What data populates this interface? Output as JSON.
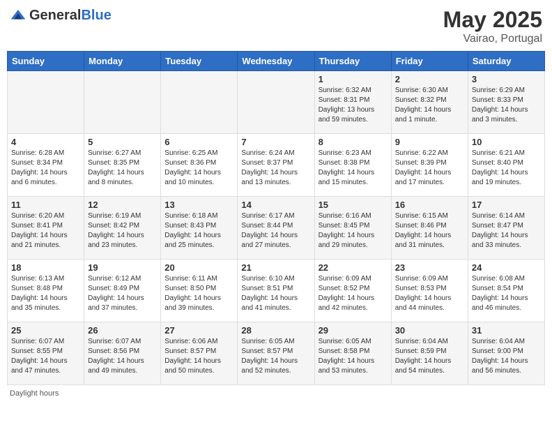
{
  "logo": {
    "general": "General",
    "blue": "Blue"
  },
  "title": "May 2025",
  "location": "Vairao, Portugal",
  "days_of_week": [
    "Sunday",
    "Monday",
    "Tuesday",
    "Wednesday",
    "Thursday",
    "Friday",
    "Saturday"
  ],
  "footer": "Daylight hours",
  "weeks": [
    [
      {
        "day": "",
        "sunrise": "",
        "sunset": "",
        "daylight": ""
      },
      {
        "day": "",
        "sunrise": "",
        "sunset": "",
        "daylight": ""
      },
      {
        "day": "",
        "sunrise": "",
        "sunset": "",
        "daylight": ""
      },
      {
        "day": "",
        "sunrise": "",
        "sunset": "",
        "daylight": ""
      },
      {
        "day": "1",
        "sunrise": "Sunrise: 6:32 AM",
        "sunset": "Sunset: 8:31 PM",
        "daylight": "Daylight: 13 hours and 59 minutes."
      },
      {
        "day": "2",
        "sunrise": "Sunrise: 6:30 AM",
        "sunset": "Sunset: 8:32 PM",
        "daylight": "Daylight: 14 hours and 1 minute."
      },
      {
        "day": "3",
        "sunrise": "Sunrise: 6:29 AM",
        "sunset": "Sunset: 8:33 PM",
        "daylight": "Daylight: 14 hours and 3 minutes."
      }
    ],
    [
      {
        "day": "4",
        "sunrise": "Sunrise: 6:28 AM",
        "sunset": "Sunset: 8:34 PM",
        "daylight": "Daylight: 14 hours and 6 minutes."
      },
      {
        "day": "5",
        "sunrise": "Sunrise: 6:27 AM",
        "sunset": "Sunset: 8:35 PM",
        "daylight": "Daylight: 14 hours and 8 minutes."
      },
      {
        "day": "6",
        "sunrise": "Sunrise: 6:25 AM",
        "sunset": "Sunset: 8:36 PM",
        "daylight": "Daylight: 14 hours and 10 minutes."
      },
      {
        "day": "7",
        "sunrise": "Sunrise: 6:24 AM",
        "sunset": "Sunset: 8:37 PM",
        "daylight": "Daylight: 14 hours and 13 minutes."
      },
      {
        "day": "8",
        "sunrise": "Sunrise: 6:23 AM",
        "sunset": "Sunset: 8:38 PM",
        "daylight": "Daylight: 14 hours and 15 minutes."
      },
      {
        "day": "9",
        "sunrise": "Sunrise: 6:22 AM",
        "sunset": "Sunset: 8:39 PM",
        "daylight": "Daylight: 14 hours and 17 minutes."
      },
      {
        "day": "10",
        "sunrise": "Sunrise: 6:21 AM",
        "sunset": "Sunset: 8:40 PM",
        "daylight": "Daylight: 14 hours and 19 minutes."
      }
    ],
    [
      {
        "day": "11",
        "sunrise": "Sunrise: 6:20 AM",
        "sunset": "Sunset: 8:41 PM",
        "daylight": "Daylight: 14 hours and 21 minutes."
      },
      {
        "day": "12",
        "sunrise": "Sunrise: 6:19 AM",
        "sunset": "Sunset: 8:42 PM",
        "daylight": "Daylight: 14 hours and 23 minutes."
      },
      {
        "day": "13",
        "sunrise": "Sunrise: 6:18 AM",
        "sunset": "Sunset: 8:43 PM",
        "daylight": "Daylight: 14 hours and 25 minutes."
      },
      {
        "day": "14",
        "sunrise": "Sunrise: 6:17 AM",
        "sunset": "Sunset: 8:44 PM",
        "daylight": "Daylight: 14 hours and 27 minutes."
      },
      {
        "day": "15",
        "sunrise": "Sunrise: 6:16 AM",
        "sunset": "Sunset: 8:45 PM",
        "daylight": "Daylight: 14 hours and 29 minutes."
      },
      {
        "day": "16",
        "sunrise": "Sunrise: 6:15 AM",
        "sunset": "Sunset: 8:46 PM",
        "daylight": "Daylight: 14 hours and 31 minutes."
      },
      {
        "day": "17",
        "sunrise": "Sunrise: 6:14 AM",
        "sunset": "Sunset: 8:47 PM",
        "daylight": "Daylight: 14 hours and 33 minutes."
      }
    ],
    [
      {
        "day": "18",
        "sunrise": "Sunrise: 6:13 AM",
        "sunset": "Sunset: 8:48 PM",
        "daylight": "Daylight: 14 hours and 35 minutes."
      },
      {
        "day": "19",
        "sunrise": "Sunrise: 6:12 AM",
        "sunset": "Sunset: 8:49 PM",
        "daylight": "Daylight: 14 hours and 37 minutes."
      },
      {
        "day": "20",
        "sunrise": "Sunrise: 6:11 AM",
        "sunset": "Sunset: 8:50 PM",
        "daylight": "Daylight: 14 hours and 39 minutes."
      },
      {
        "day": "21",
        "sunrise": "Sunrise: 6:10 AM",
        "sunset": "Sunset: 8:51 PM",
        "daylight": "Daylight: 14 hours and 41 minutes."
      },
      {
        "day": "22",
        "sunrise": "Sunrise: 6:09 AM",
        "sunset": "Sunset: 8:52 PM",
        "daylight": "Daylight: 14 hours and 42 minutes."
      },
      {
        "day": "23",
        "sunrise": "Sunrise: 6:09 AM",
        "sunset": "Sunset: 8:53 PM",
        "daylight": "Daylight: 14 hours and 44 minutes."
      },
      {
        "day": "24",
        "sunrise": "Sunrise: 6:08 AM",
        "sunset": "Sunset: 8:54 PM",
        "daylight": "Daylight: 14 hours and 46 minutes."
      }
    ],
    [
      {
        "day": "25",
        "sunrise": "Sunrise: 6:07 AM",
        "sunset": "Sunset: 8:55 PM",
        "daylight": "Daylight: 14 hours and 47 minutes."
      },
      {
        "day": "26",
        "sunrise": "Sunrise: 6:07 AM",
        "sunset": "Sunset: 8:56 PM",
        "daylight": "Daylight: 14 hours and 49 minutes."
      },
      {
        "day": "27",
        "sunrise": "Sunrise: 6:06 AM",
        "sunset": "Sunset: 8:57 PM",
        "daylight": "Daylight: 14 hours and 50 minutes."
      },
      {
        "day": "28",
        "sunrise": "Sunrise: 6:05 AM",
        "sunset": "Sunset: 8:57 PM",
        "daylight": "Daylight: 14 hours and 52 minutes."
      },
      {
        "day": "29",
        "sunrise": "Sunrise: 6:05 AM",
        "sunset": "Sunset: 8:58 PM",
        "daylight": "Daylight: 14 hours and 53 minutes."
      },
      {
        "day": "30",
        "sunrise": "Sunrise: 6:04 AM",
        "sunset": "Sunset: 8:59 PM",
        "daylight": "Daylight: 14 hours and 54 minutes."
      },
      {
        "day": "31",
        "sunrise": "Sunrise: 6:04 AM",
        "sunset": "Sunset: 9:00 PM",
        "daylight": "Daylight: 14 hours and 56 minutes."
      }
    ]
  ]
}
